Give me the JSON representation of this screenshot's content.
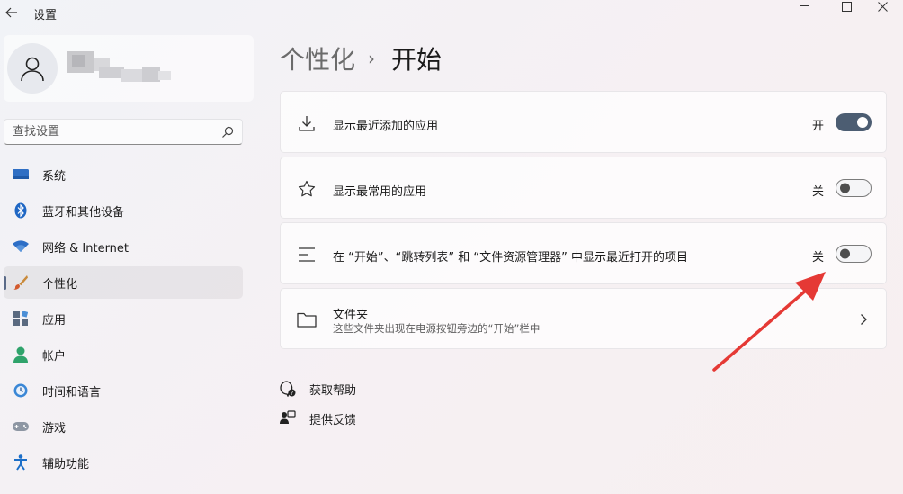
{
  "window": {
    "title": "设置",
    "back_icon": "back-arrow-icon",
    "controls": [
      "minimize-icon",
      "maximize-icon",
      "close-icon"
    ]
  },
  "profile": {
    "avatar_icon": "user-avatar-icon"
  },
  "search": {
    "placeholder": "查找设置",
    "value": "",
    "icon": "search-icon"
  },
  "sidebar": {
    "items": [
      {
        "label": "系统",
        "icon": "system-display-icon",
        "active": false
      },
      {
        "label": "蓝牙和其他设备",
        "icon": "bluetooth-icon",
        "active": false
      },
      {
        "label": "网络 & Internet",
        "icon": "wifi-icon",
        "active": false
      },
      {
        "label": "个性化",
        "icon": "brush-icon",
        "active": true
      },
      {
        "label": "应用",
        "icon": "apps-icon",
        "active": false
      },
      {
        "label": "帐户",
        "icon": "account-icon",
        "active": false
      },
      {
        "label": "时间和语言",
        "icon": "time-language-icon",
        "active": false
      },
      {
        "label": "游戏",
        "icon": "gamepad-icon",
        "active": false
      },
      {
        "label": "辅助功能",
        "icon": "accessibility-icon",
        "active": false
      }
    ]
  },
  "breadcrumb": {
    "parent": "个性化",
    "separator": "›",
    "current": "开始"
  },
  "settings": [
    {
      "label": "显示最近添加的应用",
      "icon": "download-icon",
      "state_text": "开",
      "on": true
    },
    {
      "label": "显示最常用的应用",
      "icon": "star-icon",
      "state_text": "关",
      "on": false
    },
    {
      "label": "在 “开始”、“跳转列表” 和 “文件资源管理器” 中显示最近打开的项目",
      "icon": "list-icon",
      "state_text": "关",
      "on": false
    }
  ],
  "folders": {
    "title": "文件夹",
    "subtitle": "这些文件夹出现在电源按钮旁边的“开始”栏中",
    "icon": "folder-icon"
  },
  "links": [
    {
      "label": "获取帮助",
      "icon": "help-icon"
    },
    {
      "label": "提供反馈",
      "icon": "feedback-icon"
    }
  ],
  "colors": {
    "accent": "#4c5d72",
    "annotation_arrow": "#e53935"
  }
}
